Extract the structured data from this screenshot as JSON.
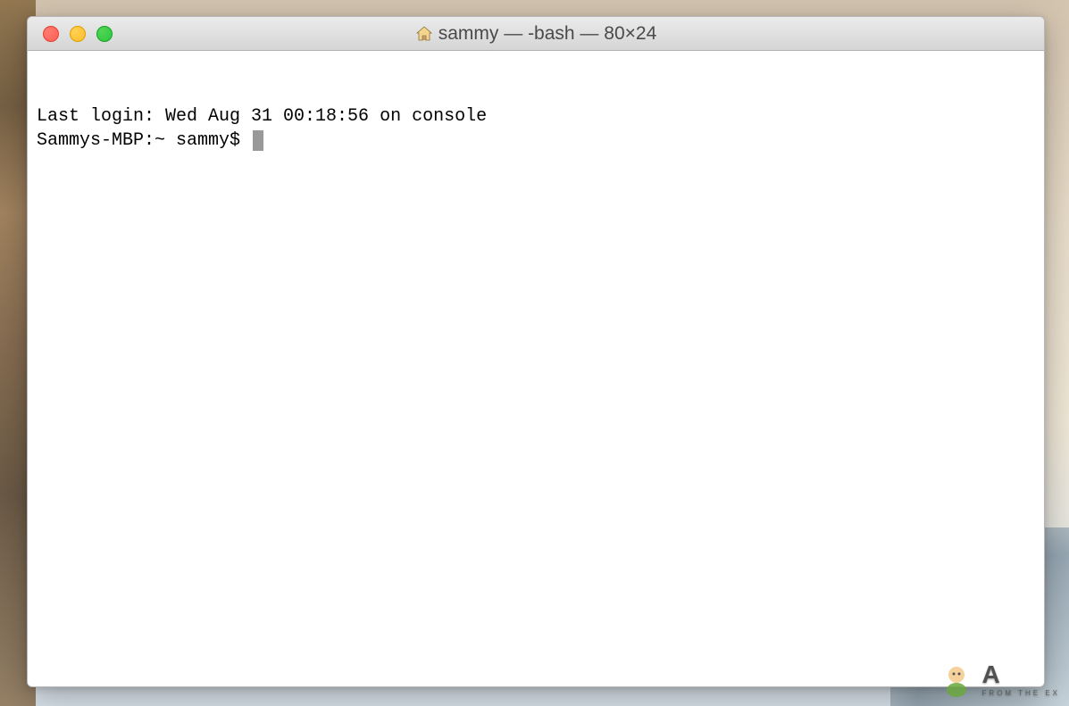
{
  "window": {
    "title": "sammy — -bash — 80×24",
    "icon": "home-icon"
  },
  "traffic_lights": {
    "close": "close",
    "minimize": "minimize",
    "maximize": "maximize"
  },
  "terminal": {
    "lines": [
      "Last login: Wed Aug 31 00:18:56 on console"
    ],
    "prompt": "Sammys-MBP:~ sammy$ "
  },
  "watermark": {
    "brand": "A",
    "tagline": "FROM THE EX"
  }
}
